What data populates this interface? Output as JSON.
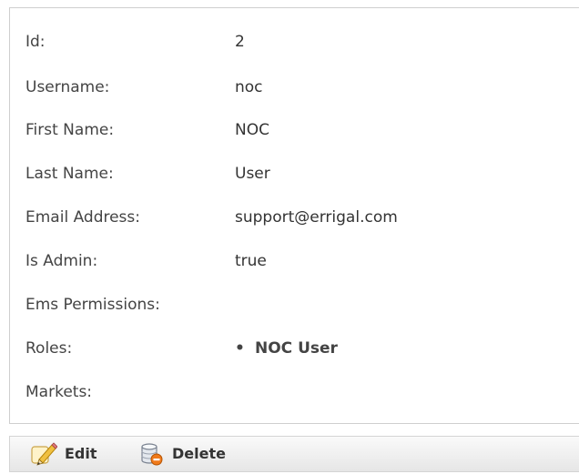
{
  "details": [
    {
      "label": "Id:",
      "value": "2"
    },
    {
      "label": "Username:",
      "value": "noc"
    },
    {
      "label": "First Name:",
      "value": "NOC"
    },
    {
      "label": "Last Name:",
      "value": "User"
    },
    {
      "label": "Email Address:",
      "value": "support@errigal.com"
    },
    {
      "label": "Is Admin:",
      "value": "true"
    },
    {
      "label": "Ems Permissions:",
      "value": ""
    },
    {
      "label": "Roles:",
      "value": ""
    },
    {
      "label": "Markets:",
      "value": ""
    }
  ],
  "roles": [
    "NOC User"
  ],
  "toolbar": {
    "edit_label": "Edit",
    "delete_label": "Delete"
  },
  "colors": {
    "border": "#cfcfcf",
    "toolbar_bg": "#e6e6e6",
    "text": "#333333"
  },
  "icons": {
    "edit": "pencil-edit-icon",
    "delete": "database-delete-icon"
  }
}
